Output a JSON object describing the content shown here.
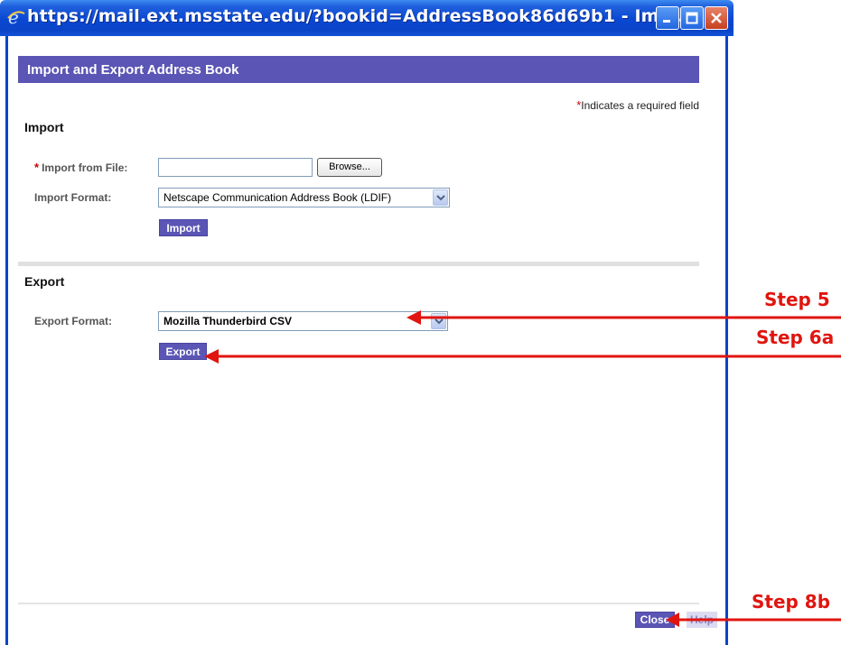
{
  "window": {
    "title": "https://mail.ext.msstate.edu/?bookid=AddressBook86d69b1 - Imp...",
    "icon": "ie-icon",
    "controls": [
      "minimize-icon",
      "maximize-icon",
      "close-icon"
    ]
  },
  "dialog": {
    "header": "Import and Export Address Book",
    "required_note": "Indicates a required field",
    "required_star": "*"
  },
  "import": {
    "section_title": "Import",
    "file_label": "Import from File:",
    "file_value": "",
    "browse_label": "Browse...",
    "format_label": "Import Format:",
    "format_selected": "Netscape Communication Address Book (LDIF)",
    "import_button": "Import"
  },
  "export": {
    "section_title": "Export",
    "format_label": "Export Format:",
    "format_selected": "Mozilla Thunderbird CSV",
    "export_button": "Export"
  },
  "footer": {
    "close_button": "Close",
    "help_button": "Help"
  },
  "annotations": {
    "step5": "Step 5",
    "step6a": "Step 6a",
    "step8b": "Step 8b",
    "color": "#e0150f"
  },
  "colors": {
    "accent": "#5b55b5",
    "titlebar": "#0a47d2",
    "required": "#cc0000"
  }
}
